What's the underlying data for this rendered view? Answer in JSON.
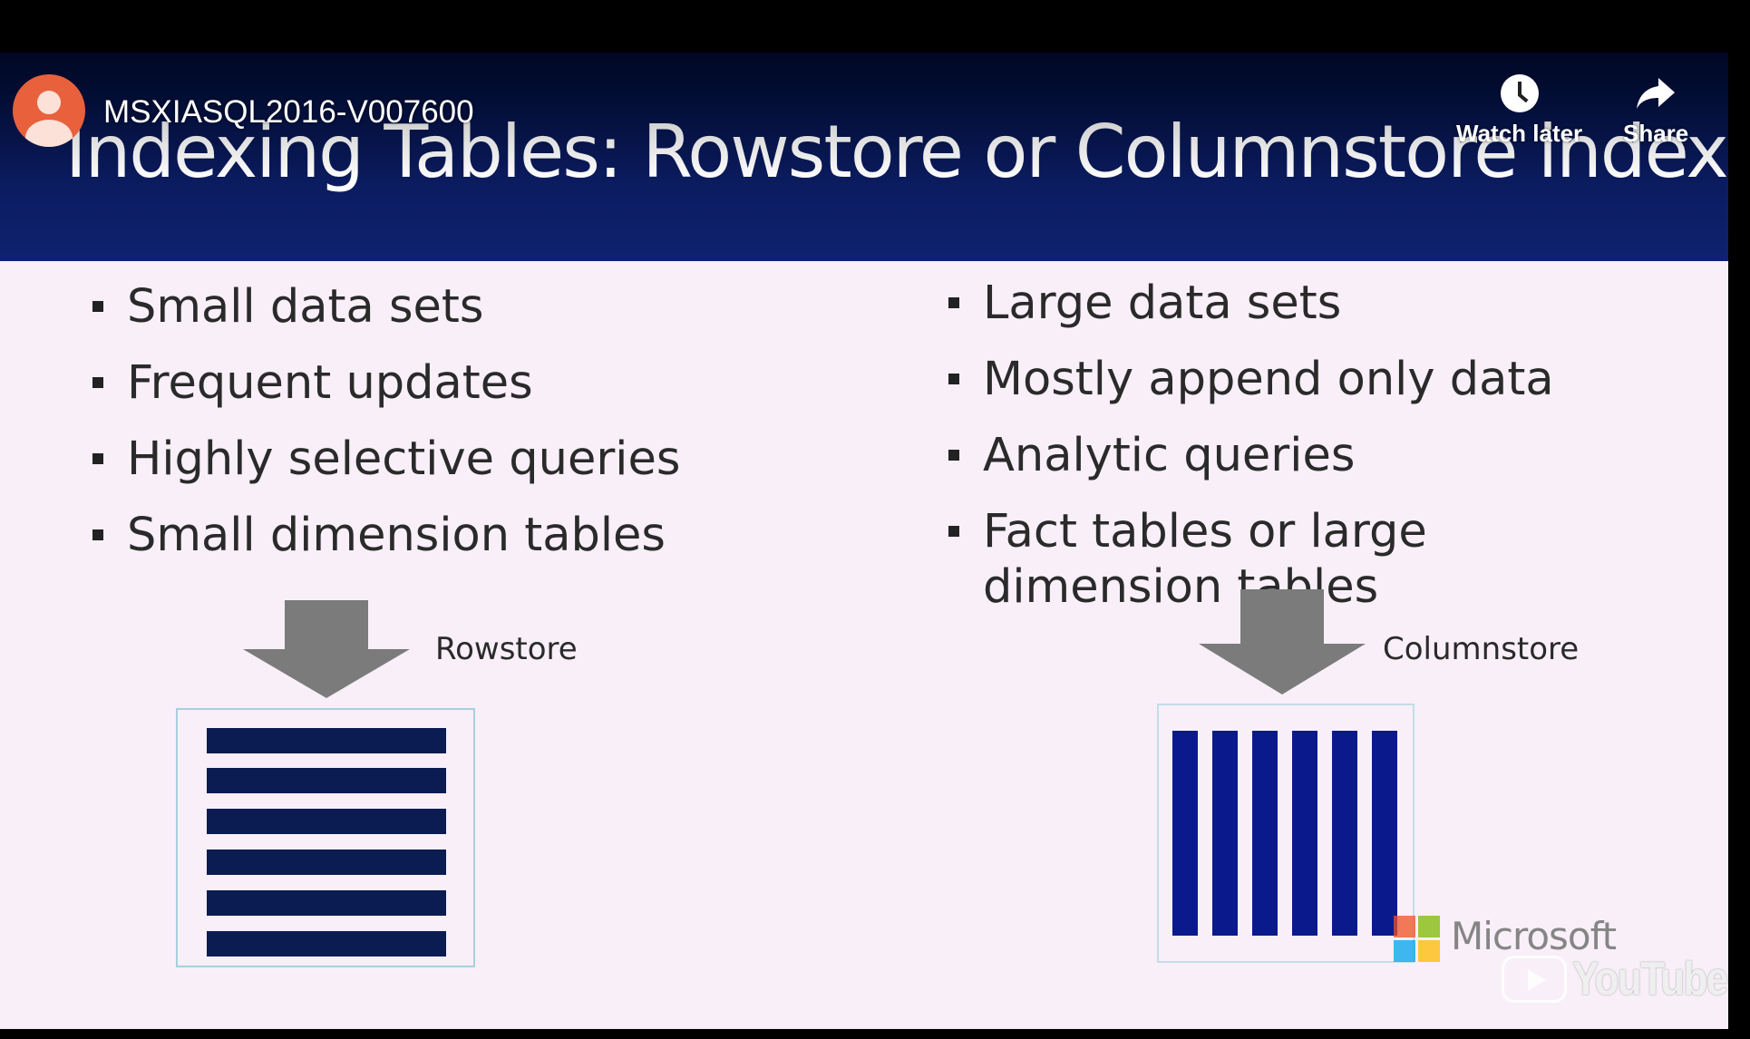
{
  "video": {
    "title": "MSXIASQL2016-V007600",
    "actions": [
      {
        "label": "Watch later",
        "icon": "clock-icon"
      },
      {
        "label": "Share",
        "icon": "share-arrow-icon"
      }
    ]
  },
  "slide": {
    "title": "Indexing Tables: Rowstore or Columnstore index?",
    "left_bullets": [
      "Small data sets",
      "Frequent updates",
      "Highly selective queries",
      "Small dimension tables"
    ],
    "right_bullets": [
      "Large data sets",
      "Mostly append only data",
      "Analytic queries",
      "Fact tables or large dimension tables"
    ],
    "rowstore_label": "Rowstore",
    "columnstore_label": "Columnstore",
    "brand_text": "Microsoft"
  },
  "watermark": {
    "text": "YouTube"
  },
  "colors": {
    "header_bg": "#0c1d63",
    "slide_bg": "#f8eff8",
    "rowstore_bar": "#0a1c52",
    "columnstore_bar": "#0a1a8c",
    "arrow": "#7b7b7b",
    "avatar": "#e8613c"
  }
}
